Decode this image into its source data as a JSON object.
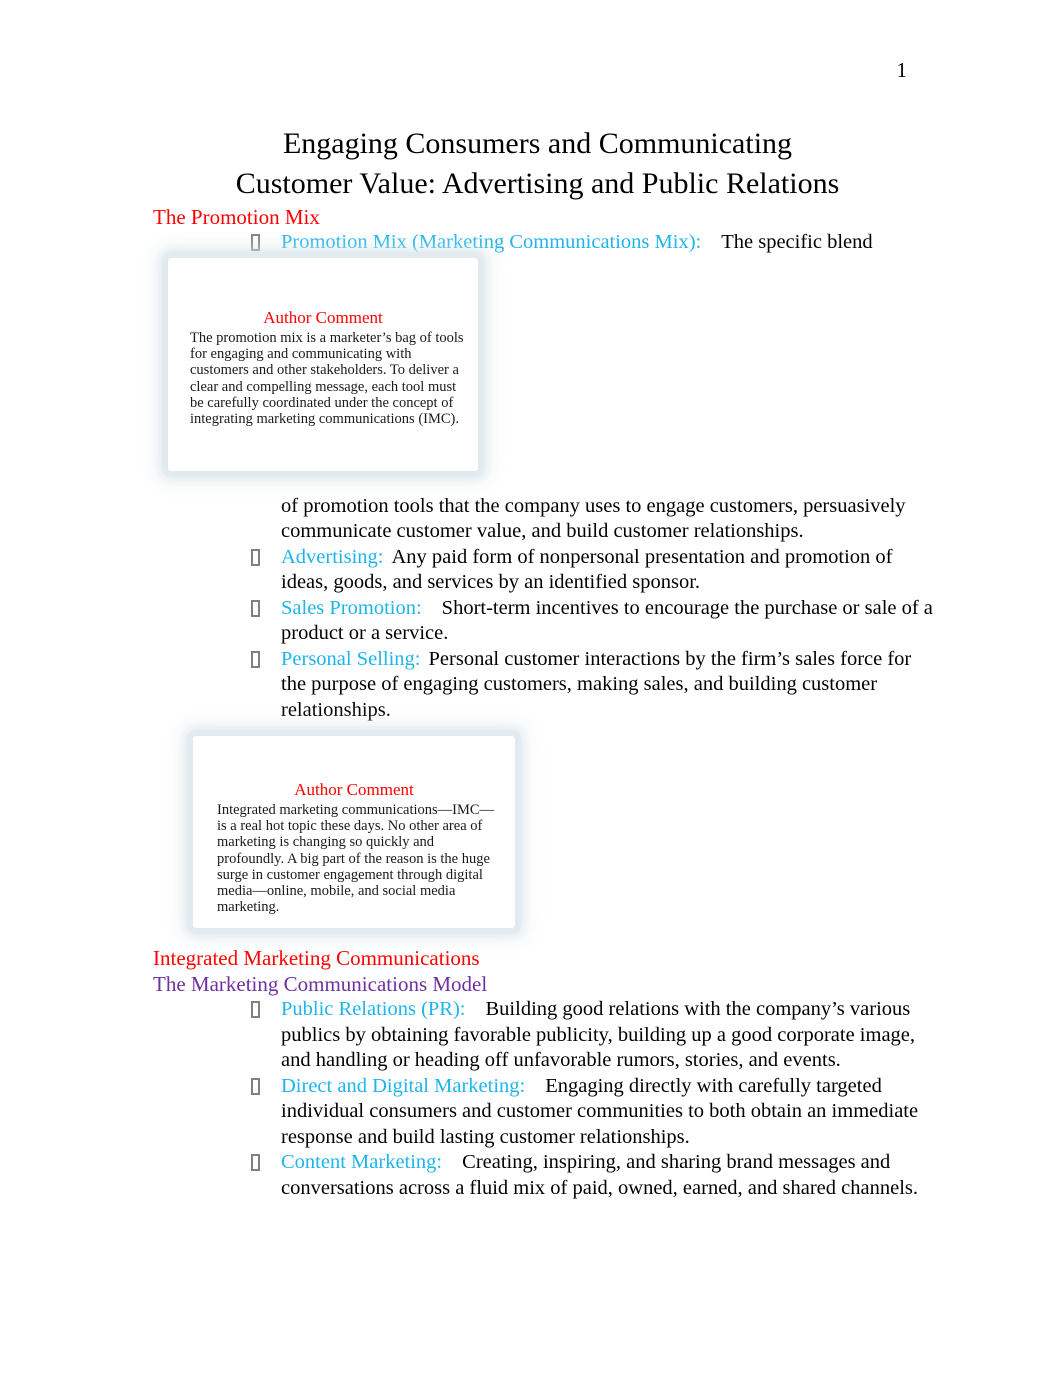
{
  "page": {
    "number": "1"
  },
  "title": {
    "line1": "Engaging Consumers and Communicating",
    "line2": "Customer Value: Advertising and Public Relations"
  },
  "colors": {
    "heading_red": "#FF0000",
    "heading_purple": "#7030A0",
    "term_cyan": "#1EB4EC",
    "body_black": "#000000"
  },
  "sections": {
    "promotion_mix_heading": "The Promotion Mix",
    "imc_heading": "Integrated Marketing Communications",
    "marcom_model_heading": "The Marketing Communications Model"
  },
  "bullets": {
    "promotion_mix": {
      "term": "Promotion Mix (Marketing Communications Mix):",
      "definition_part1": "The specific blend",
      "definition_part2": "of promotion tools that the company uses to engage customers, persuasively communicate customer value, and build customer relationships."
    },
    "advertising": {
      "term": "Advertising:",
      "definition": "Any paid form of nonpersonal presentation and promotion of ideas, goods, and services by an identified sponsor."
    },
    "sales_promotion": {
      "term": "Sales Promotion:",
      "definition": "Short-term incentives to encourage the purchase or sale of a product or a service."
    },
    "personal_selling": {
      "term": "Personal Selling:",
      "definition": "Personal customer interactions by the firm’s sales force for the purpose of engaging customers, making sales, and building customer relationships."
    },
    "public_relations": {
      "term": "Public Relations (PR):",
      "definition": "Building good relations with the company’s various publics by obtaining favorable publicity, building up a good corporate image, and handling or heading off unfavorable rumors, stories, and events."
    },
    "direct_digital": {
      "term": "Direct and Digital Marketing:",
      "definition": "Engaging directly with carefully targeted individual consumers and customer communities to both obtain an immediate response and build lasting customer relationships."
    },
    "content_marketing": {
      "term": "Content Marketing:",
      "definition": "Creating, inspiring, and sharing brand messages and conversations across a fluid mix of paid, owned, earned, and shared channels."
    }
  },
  "author_comments": [
    {
      "title": "Author Comment",
      "body": "The promotion mix is a marketer’s bag of tools for engaging and communicating with customers and other stakeholders. To deliver a clear and compelling message, each tool must be carefully coordinated under the concept of integrating marketing communications (IMC)."
    },
    {
      "title": "Author Comment",
      "body": "Integrated marketing communications—IMC—is a real hot topic these days. No other area of marketing is changing so quickly and profoundly. A big part of the reason is the huge surge in customer engagement through digital media—online, mobile, and social media marketing."
    }
  ]
}
